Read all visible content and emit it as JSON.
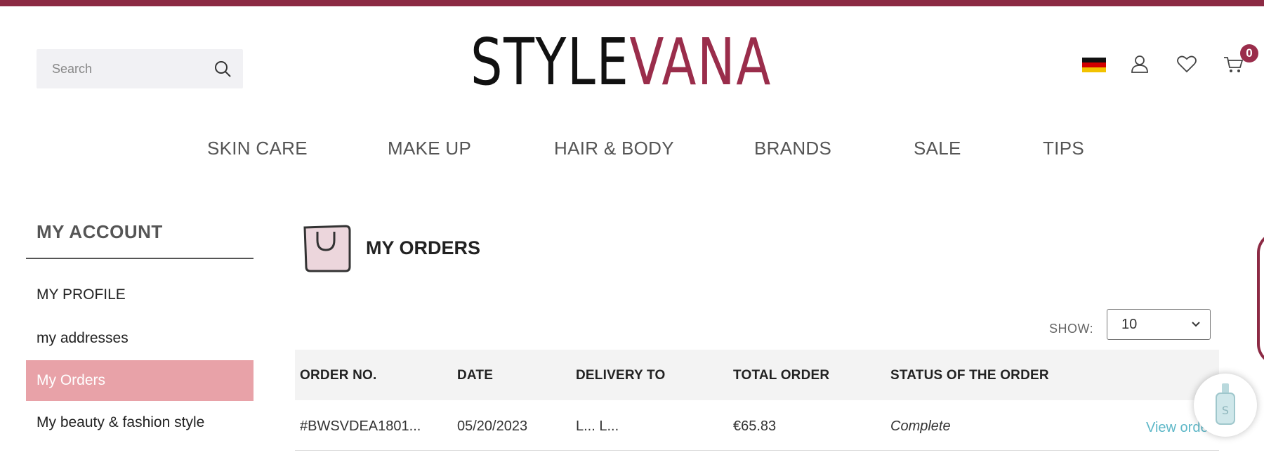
{
  "header": {
    "search_placeholder": "Search",
    "logo_part1": "STYLE",
    "logo_part2": "VANA",
    "cart_count": "0",
    "icons": [
      "search-icon",
      "germany-flag-icon",
      "user-icon",
      "heart-icon",
      "cart-icon"
    ]
  },
  "nav": {
    "items": [
      "SKIN CARE",
      "MAKE UP",
      "HAIR & BODY",
      "BRANDS",
      "SALE",
      "TIPS"
    ]
  },
  "sidebar": {
    "title": "MY ACCOUNT",
    "items": [
      {
        "label": "MY PROFILE",
        "active": false
      },
      {
        "label": "my addresses",
        "active": false
      },
      {
        "label": "My Orders",
        "active": true
      },
      {
        "label": "My beauty & fashion style",
        "active": false
      }
    ]
  },
  "main": {
    "title": "MY ORDERS",
    "show_label": "SHOW:",
    "show_value": "10",
    "columns": [
      "ORDER NO.",
      "DATE",
      "DELIVERY TO",
      "TOTAL ORDER",
      "STATUS OF THE ORDER"
    ],
    "rows": [
      {
        "order_no": "#BWSVDEA1801...",
        "date": "05/20/2023",
        "delivery_to": "L... L...",
        "total": "€65.83",
        "status": "Complete",
        "action": "View order"
      }
    ]
  },
  "colors": {
    "brand": "#8c2a44",
    "active_item": "#e8a2a8",
    "link": "#5fb8c8"
  }
}
